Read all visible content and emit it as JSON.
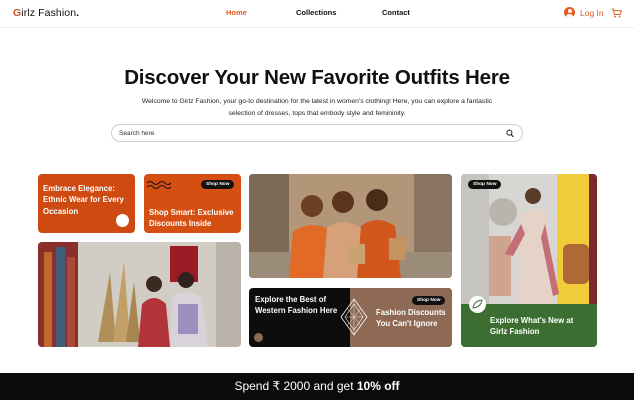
{
  "brand": {
    "name_accent": "G",
    "name_rest": "irlz Fashion",
    "dot": ".",
    "accent_color": "#c9561e"
  },
  "nav": {
    "links": [
      {
        "label": "Home",
        "active": true
      },
      {
        "label": "Collections",
        "active": false
      },
      {
        "label": "Contact",
        "active": false
      }
    ],
    "login_label": "Log In",
    "icons": [
      "user-icon",
      "cart-icon"
    ]
  },
  "hero": {
    "title": "Discover Your New Favorite Outfits Here",
    "description_line1": "Welcome to Girlz Fashion, your go-to destination for the latest in women's clothing! Here, you can explore a fantastic",
    "description_line2": "selection of dresses, tops that embody style and femininity.",
    "search_placeholder": "Search here"
  },
  "cards": {
    "ethnic": {
      "title": "Embrace Elegance: Ethnic Wear for Every Occasion",
      "color": "#cf4a11"
    },
    "shop_smart": {
      "pill": "Shop Now",
      "title": "Shop Smart: Exclusive Discounts Inside",
      "color": "#d64f12"
    },
    "western": {
      "title": "Explore the Best of Western Fashion Here",
      "pill": "Shop Now",
      "discount_title": "Fashion Discounts You Can't Ignore"
    },
    "whats_new": {
      "pill": "Shop Now",
      "title": "Explore What's New at Girlz Fashion",
      "color": "#3c6e31"
    }
  },
  "promo": {
    "prefix": "Spend ₹ 2000 and get ",
    "highlight": "10% off"
  }
}
